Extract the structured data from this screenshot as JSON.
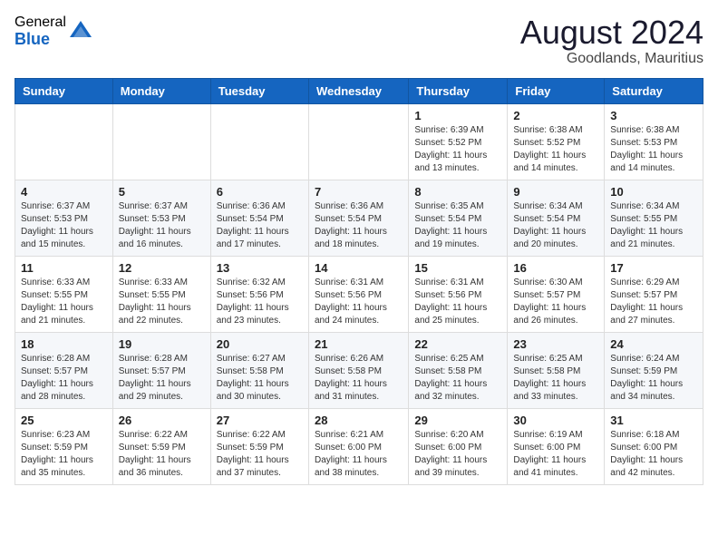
{
  "header": {
    "logo_general": "General",
    "logo_blue": "Blue",
    "month_year": "August 2024",
    "location": "Goodlands, Mauritius"
  },
  "days_of_week": [
    "Sunday",
    "Monday",
    "Tuesday",
    "Wednesday",
    "Thursday",
    "Friday",
    "Saturday"
  ],
  "weeks": [
    [
      {
        "day": "",
        "info": ""
      },
      {
        "day": "",
        "info": ""
      },
      {
        "day": "",
        "info": ""
      },
      {
        "day": "",
        "info": ""
      },
      {
        "day": "1",
        "info": "Sunrise: 6:39 AM\nSunset: 5:52 PM\nDaylight: 11 hours and 13 minutes."
      },
      {
        "day": "2",
        "info": "Sunrise: 6:38 AM\nSunset: 5:52 PM\nDaylight: 11 hours and 14 minutes."
      },
      {
        "day": "3",
        "info": "Sunrise: 6:38 AM\nSunset: 5:53 PM\nDaylight: 11 hours and 14 minutes."
      }
    ],
    [
      {
        "day": "4",
        "info": "Sunrise: 6:37 AM\nSunset: 5:53 PM\nDaylight: 11 hours and 15 minutes."
      },
      {
        "day": "5",
        "info": "Sunrise: 6:37 AM\nSunset: 5:53 PM\nDaylight: 11 hours and 16 minutes."
      },
      {
        "day": "6",
        "info": "Sunrise: 6:36 AM\nSunset: 5:54 PM\nDaylight: 11 hours and 17 minutes."
      },
      {
        "day": "7",
        "info": "Sunrise: 6:36 AM\nSunset: 5:54 PM\nDaylight: 11 hours and 18 minutes."
      },
      {
        "day": "8",
        "info": "Sunrise: 6:35 AM\nSunset: 5:54 PM\nDaylight: 11 hours and 19 minutes."
      },
      {
        "day": "9",
        "info": "Sunrise: 6:34 AM\nSunset: 5:54 PM\nDaylight: 11 hours and 20 minutes."
      },
      {
        "day": "10",
        "info": "Sunrise: 6:34 AM\nSunset: 5:55 PM\nDaylight: 11 hours and 21 minutes."
      }
    ],
    [
      {
        "day": "11",
        "info": "Sunrise: 6:33 AM\nSunset: 5:55 PM\nDaylight: 11 hours and 21 minutes."
      },
      {
        "day": "12",
        "info": "Sunrise: 6:33 AM\nSunset: 5:55 PM\nDaylight: 11 hours and 22 minutes."
      },
      {
        "day": "13",
        "info": "Sunrise: 6:32 AM\nSunset: 5:56 PM\nDaylight: 11 hours and 23 minutes."
      },
      {
        "day": "14",
        "info": "Sunrise: 6:31 AM\nSunset: 5:56 PM\nDaylight: 11 hours and 24 minutes."
      },
      {
        "day": "15",
        "info": "Sunrise: 6:31 AM\nSunset: 5:56 PM\nDaylight: 11 hours and 25 minutes."
      },
      {
        "day": "16",
        "info": "Sunrise: 6:30 AM\nSunset: 5:57 PM\nDaylight: 11 hours and 26 minutes."
      },
      {
        "day": "17",
        "info": "Sunrise: 6:29 AM\nSunset: 5:57 PM\nDaylight: 11 hours and 27 minutes."
      }
    ],
    [
      {
        "day": "18",
        "info": "Sunrise: 6:28 AM\nSunset: 5:57 PM\nDaylight: 11 hours and 28 minutes."
      },
      {
        "day": "19",
        "info": "Sunrise: 6:28 AM\nSunset: 5:57 PM\nDaylight: 11 hours and 29 minutes."
      },
      {
        "day": "20",
        "info": "Sunrise: 6:27 AM\nSunset: 5:58 PM\nDaylight: 11 hours and 30 minutes."
      },
      {
        "day": "21",
        "info": "Sunrise: 6:26 AM\nSunset: 5:58 PM\nDaylight: 11 hours and 31 minutes."
      },
      {
        "day": "22",
        "info": "Sunrise: 6:25 AM\nSunset: 5:58 PM\nDaylight: 11 hours and 32 minutes."
      },
      {
        "day": "23",
        "info": "Sunrise: 6:25 AM\nSunset: 5:58 PM\nDaylight: 11 hours and 33 minutes."
      },
      {
        "day": "24",
        "info": "Sunrise: 6:24 AM\nSunset: 5:59 PM\nDaylight: 11 hours and 34 minutes."
      }
    ],
    [
      {
        "day": "25",
        "info": "Sunrise: 6:23 AM\nSunset: 5:59 PM\nDaylight: 11 hours and 35 minutes."
      },
      {
        "day": "26",
        "info": "Sunrise: 6:22 AM\nSunset: 5:59 PM\nDaylight: 11 hours and 36 minutes."
      },
      {
        "day": "27",
        "info": "Sunrise: 6:22 AM\nSunset: 5:59 PM\nDaylight: 11 hours and 37 minutes."
      },
      {
        "day": "28",
        "info": "Sunrise: 6:21 AM\nSunset: 6:00 PM\nDaylight: 11 hours and 38 minutes."
      },
      {
        "day": "29",
        "info": "Sunrise: 6:20 AM\nSunset: 6:00 PM\nDaylight: 11 hours and 39 minutes."
      },
      {
        "day": "30",
        "info": "Sunrise: 6:19 AM\nSunset: 6:00 PM\nDaylight: 11 hours and 41 minutes."
      },
      {
        "day": "31",
        "info": "Sunrise: 6:18 AM\nSunset: 6:00 PM\nDaylight: 11 hours and 42 minutes."
      }
    ]
  ]
}
